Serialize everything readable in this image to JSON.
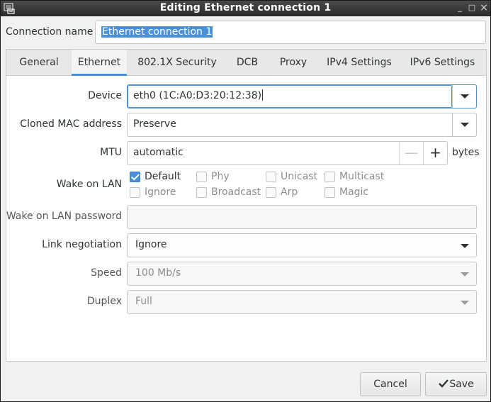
{
  "window": {
    "title": "Editing Ethernet connection 1",
    "controls": {
      "minimize": "_",
      "maximize": "□",
      "close": "×"
    }
  },
  "connection_name": {
    "label": "Connection name",
    "value": "Ethernet connection 1"
  },
  "tabs": [
    {
      "label": "General"
    },
    {
      "label": "Ethernet",
      "active": true
    },
    {
      "label": "802.1X Security"
    },
    {
      "label": "DCB"
    },
    {
      "label": "Proxy"
    },
    {
      "label": "IPv4 Settings"
    },
    {
      "label": "IPv6 Settings"
    }
  ],
  "ethernet": {
    "device": {
      "label": "Device",
      "value": "eth0 (1C:A0:D3:20:12:38)"
    },
    "cloned_mac": {
      "label": "Cloned MAC address",
      "value": "Preserve"
    },
    "mtu": {
      "label": "MTU",
      "value": "automatic",
      "unit": "bytes",
      "minus": "—",
      "plus": "+"
    },
    "wake_on_lan": {
      "label": "Wake on LAN",
      "options": [
        {
          "label": "Default",
          "checked": true
        },
        {
          "label": "Phy",
          "checked": false
        },
        {
          "label": "Unicast",
          "checked": false
        },
        {
          "label": "Multicast",
          "checked": false
        },
        {
          "label": "Ignore",
          "checked": false
        },
        {
          "label": "Broadcast",
          "checked": false
        },
        {
          "label": "Arp",
          "checked": false
        },
        {
          "label": "Magic",
          "checked": false
        }
      ]
    },
    "wol_password": {
      "label": "Wake on LAN password",
      "value": ""
    },
    "link_negotiation": {
      "label": "Link negotiation",
      "value": "Ignore"
    },
    "speed": {
      "label": "Speed",
      "value": "100 Mb/s"
    },
    "duplex": {
      "label": "Duplex",
      "value": "Full"
    }
  },
  "buttons": {
    "cancel": "Cancel",
    "save": "Save"
  },
  "colors": {
    "accent": "#4a90d9",
    "titlebar": "#2b2b2b"
  }
}
